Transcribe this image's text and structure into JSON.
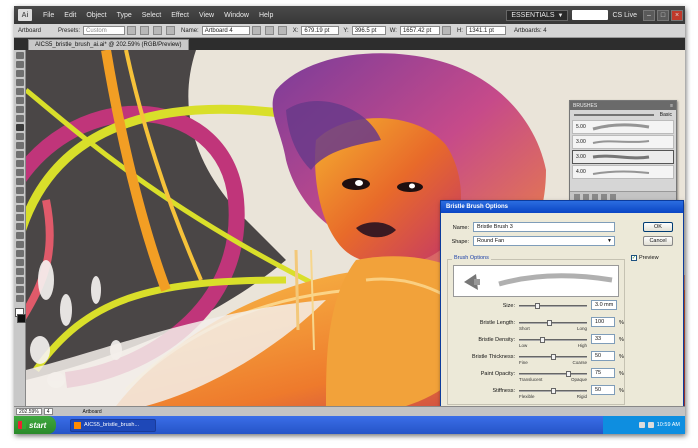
{
  "menubar": {
    "logo": "Ai",
    "items": [
      "File",
      "Edit",
      "Object",
      "Type",
      "Select",
      "Effect",
      "View",
      "Window",
      "Help"
    ],
    "workspace": "ESSENTIALS",
    "cslive": "CS Live"
  },
  "controlbar": {
    "tool_label": "Artboard",
    "presets_label": "Presets:",
    "presets_value": "Custom",
    "name_label": "Name:",
    "name_value": "Artboard 4",
    "x_label": "X:",
    "x_value": "679.19 pt",
    "y_label": "Y:",
    "y_value": "396.5 pt",
    "w_label": "W:",
    "w_value": "1657.42 pt",
    "h_label": "H:",
    "h_value": "1341.1 pt",
    "artboards_label": "Artboards: 4"
  },
  "document": {
    "tab_title": "AICS5_bristle_brush_ai.ai* @ 202.59% (RGB/Preview)"
  },
  "brushes_panel": {
    "title": "BRUSHES",
    "basic_label": "Basic",
    "brushes": [
      {
        "size": "5.00"
      },
      {
        "size": "3.00"
      },
      {
        "size": "3.00"
      },
      {
        "size": "4.00"
      }
    ]
  },
  "dialog": {
    "title": "Bristle Brush Options",
    "name_label": "Name:",
    "name_value": "Bristle Brush 3",
    "shape_label": "Shape:",
    "shape_value": "Round Fan",
    "ok_label": "OK",
    "cancel_label": "Cancel",
    "preview_label": "Preview",
    "preview_checked": true,
    "group_title": "Brush Options",
    "options": [
      {
        "label": "Size:",
        "value": "3.0 mm",
        "min": "",
        "max": "",
        "unit": "",
        "level": 0.25
      },
      {
        "label": "Bristle Length:",
        "value": "100",
        "min": "Short",
        "max": "Long",
        "unit": "%",
        "level": 0.45
      },
      {
        "label": "Bristle Density:",
        "value": "33",
        "min": "Low",
        "max": "High",
        "unit": "%",
        "level": 0.33
      },
      {
        "label": "Bristle Thickness:",
        "value": "50",
        "min": "Fine",
        "max": "Coarse",
        "unit": "%",
        "level": 0.5
      },
      {
        "label": "Paint Opacity:",
        "value": "75",
        "min": "Translucent",
        "max": "Opaque",
        "unit": "%",
        "level": 0.75
      },
      {
        "label": "Stiffness:",
        "value": "50",
        "min": "Flexible",
        "max": "Rigid",
        "unit": "%",
        "level": 0.5
      }
    ]
  },
  "statusbar": {
    "zoom": "202.59%",
    "artboard_num": "4",
    "tool": "Artboard"
  },
  "taskbar": {
    "start_label": "start",
    "task_label": "AICS5_bristle_brush...",
    "clock": "10:59 AM"
  },
  "colors": {
    "accent": "#0a45c4",
    "dialog_bg": "#ece9d8",
    "taskbar": "#2554c7"
  }
}
